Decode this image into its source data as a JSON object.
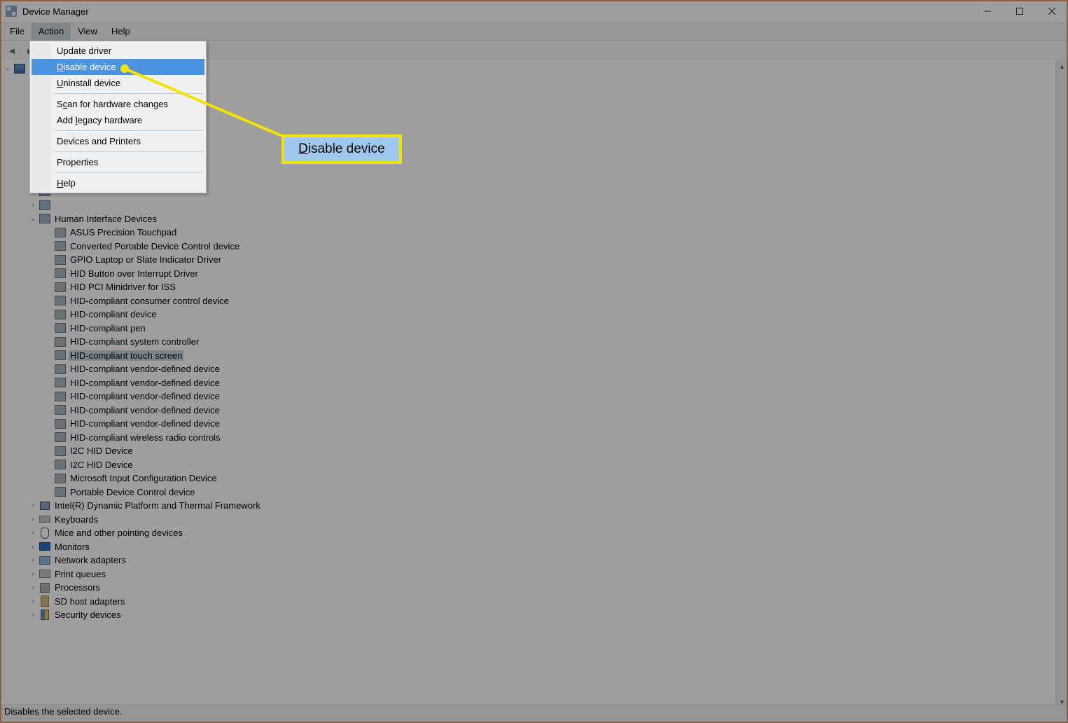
{
  "window": {
    "title": "Device Manager"
  },
  "menus": {
    "file": "File",
    "action": "Action",
    "view": "View",
    "help": "Help"
  },
  "action_menu": {
    "update_driver": "Update driver",
    "disable_device": "Disable device",
    "uninstall_device": "Uninstall device",
    "scan": "Scan for hardware changes",
    "add_legacy": "Add legacy hardware",
    "devices_printers": "Devices and Printers",
    "properties": "Properties",
    "help": "Help"
  },
  "callout": {
    "label": "Disable device"
  },
  "status": "Disables the selected device.",
  "tree": {
    "root": "",
    "hid": {
      "label": "Human Interface Devices",
      "items": [
        "ASUS Precision Touchpad",
        "Converted Portable Device Control device",
        "GPIO Laptop or Slate Indicator Driver",
        "HID Button over Interrupt Driver",
        "HID PCI Minidriver for ISS",
        "HID-compliant consumer control device",
        "HID-compliant device",
        "HID-compliant pen",
        "HID-compliant system controller",
        "HID-compliant touch screen",
        "HID-compliant vendor-defined device",
        "HID-compliant vendor-defined device",
        "HID-compliant vendor-defined device",
        "HID-compliant vendor-defined device",
        "HID-compliant vendor-defined device",
        "HID-compliant wireless radio controls",
        "I2C HID Device",
        "I2C HID Device",
        "Microsoft Input Configuration Device",
        "Portable Device Control device"
      ],
      "selected_index": 9
    },
    "cats": [
      "Intel(R) Dynamic Platform and Thermal Framework",
      "Keyboards",
      "Mice and other pointing devices",
      "Monitors",
      "Network adapters",
      "Print queues",
      "Processors",
      "SD host adapters",
      "Security devices"
    ]
  }
}
